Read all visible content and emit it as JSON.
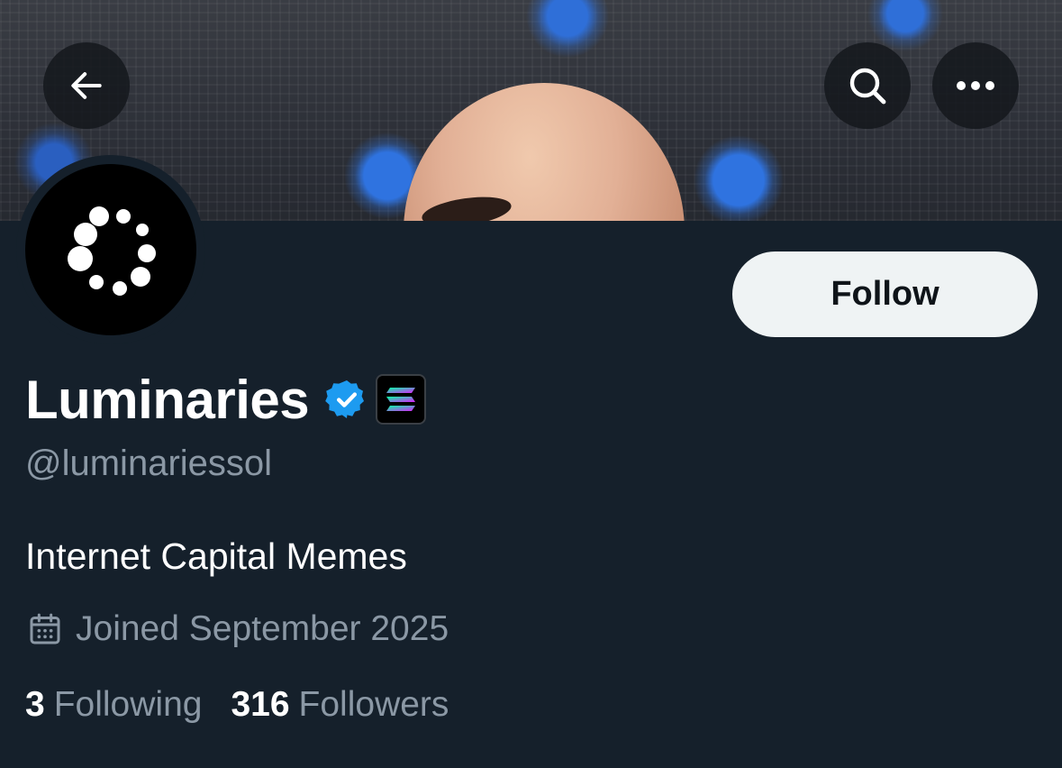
{
  "header": {
    "back_icon": "arrow-left-icon",
    "search_icon": "search-icon",
    "more_icon": "more-horizontal-icon"
  },
  "profile": {
    "display_name": "Luminaries",
    "handle": "@luminariessol",
    "bio": "Internet Capital Memes",
    "joined": "Joined September 2025",
    "verified_color": "#1d9bf0",
    "follow_label": "Follow"
  },
  "stats": {
    "following_count": "3",
    "following_label": "Following",
    "followers_count": "316",
    "followers_label": "Followers"
  },
  "colors": {
    "background": "#15202b",
    "primary_text": "#ffffff",
    "secondary_text": "#8b98a5",
    "follow_button_bg": "#eff3f4"
  }
}
